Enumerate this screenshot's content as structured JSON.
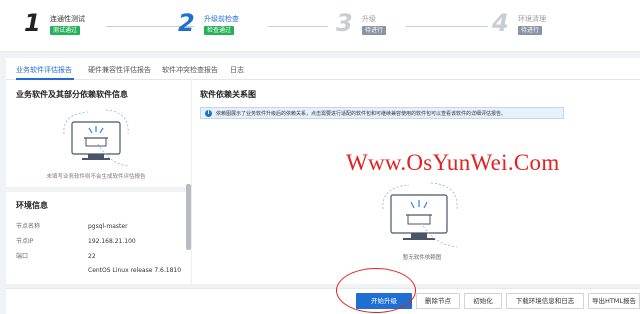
{
  "stepper": {
    "steps": [
      {
        "num": "1",
        "title": "连通性测试",
        "badge": "测试通过"
      },
      {
        "num": "2",
        "title": "升级前检查",
        "badge": "检查通过"
      },
      {
        "num": "3",
        "title": "升级",
        "badge": "待进行"
      },
      {
        "num": "4",
        "title": "环境清理",
        "badge": "待进行"
      }
    ]
  },
  "tabs": [
    "业务软件评估报告",
    "硬件兼容性评估报告",
    "软件冲突检查报告",
    "日志"
  ],
  "left": {
    "title": "业务软件及其部分依赖软件信息",
    "empty_text": "未填写业务软件则不会生成软件评估报告",
    "env_title": "环境信息",
    "env": [
      {
        "key": "节点名称",
        "value": "pgsql-master"
      },
      {
        "key": "节点IP",
        "value": "192.168.21.100"
      },
      {
        "key": "端口",
        "value": "22"
      },
      {
        "key": "",
        "value": "CentOS Linux release 7.6.1810"
      }
    ]
  },
  "right": {
    "title": "软件依赖关系图",
    "info_icon": "i",
    "info_text": "依赖图展示了业务软件升级后的依赖关系，点击需要进行适配的软件包和可继续兼容使用的软件包可以查看该软件的详细评估报告。",
    "empty_text": "暂无软件依赖图"
  },
  "watermark": "Www.OsYunWei.Com",
  "footer": {
    "buttons": [
      "开始升级",
      "删除节点",
      "初始化",
      "下载环境信息和日志",
      "导出HTML报告"
    ]
  },
  "colors": {
    "accent": "#1f6fd3",
    "success": "#25b15a",
    "pending": "#8a93a3",
    "watermark": "#e42020"
  }
}
